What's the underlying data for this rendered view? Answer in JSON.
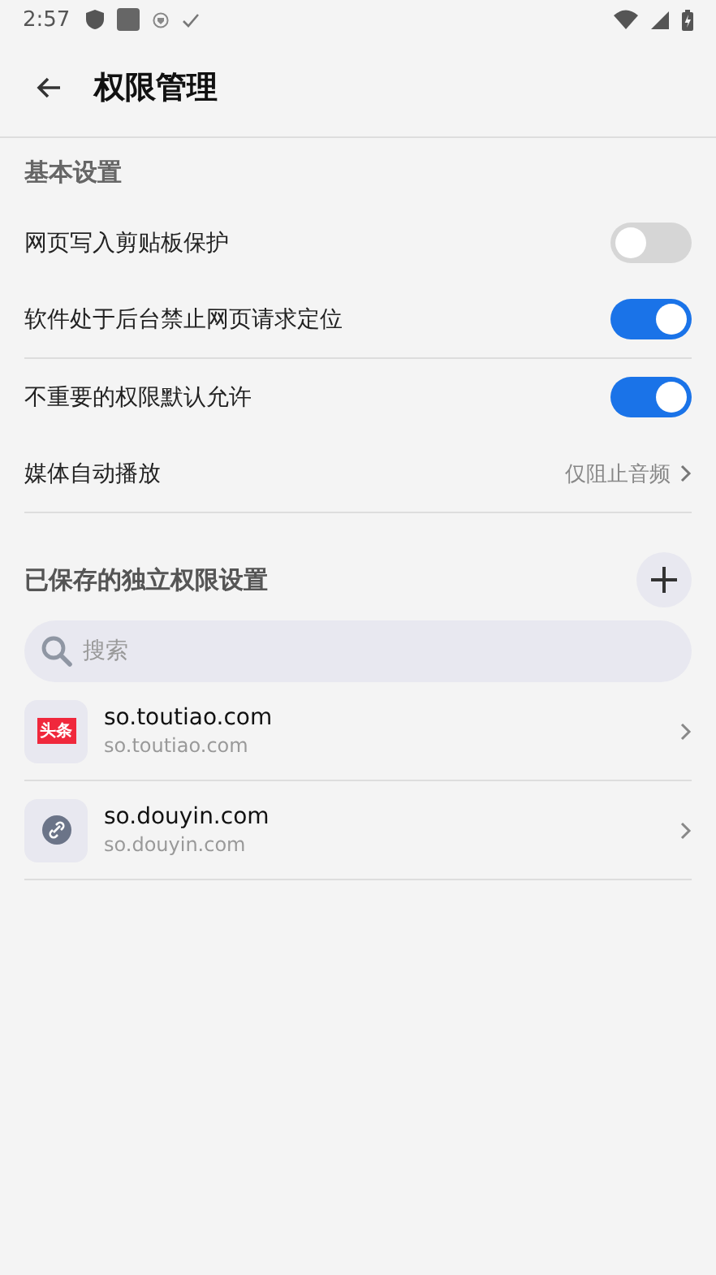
{
  "status_bar": {
    "time": "2:57"
  },
  "app_bar": {
    "title": "权限管理"
  },
  "basic_section": {
    "title": "基本设置",
    "items": [
      {
        "kind": "toggle",
        "label": "网页写入剪贴板保护",
        "on": false,
        "divider_below": false
      },
      {
        "kind": "toggle",
        "label": "软件处于后台禁止网页请求定位",
        "on": true,
        "divider_below": true
      },
      {
        "kind": "toggle",
        "label": "不重要的权限默认允许",
        "on": true,
        "divider_below": false
      },
      {
        "kind": "value",
        "label": "媒体自动播放",
        "value": "仅阻止音频",
        "divider_below": true
      }
    ]
  },
  "saved_section": {
    "title": "已保存的独立权限设置",
    "search": {
      "placeholder": "搜索"
    },
    "sites": [
      {
        "kind": "logo",
        "logo_text": "头条",
        "name": "so.toutiao.com",
        "url": "so.toutiao.com"
      },
      {
        "kind": "link",
        "name": "so.douyin.com",
        "url": "so.douyin.com"
      }
    ]
  }
}
